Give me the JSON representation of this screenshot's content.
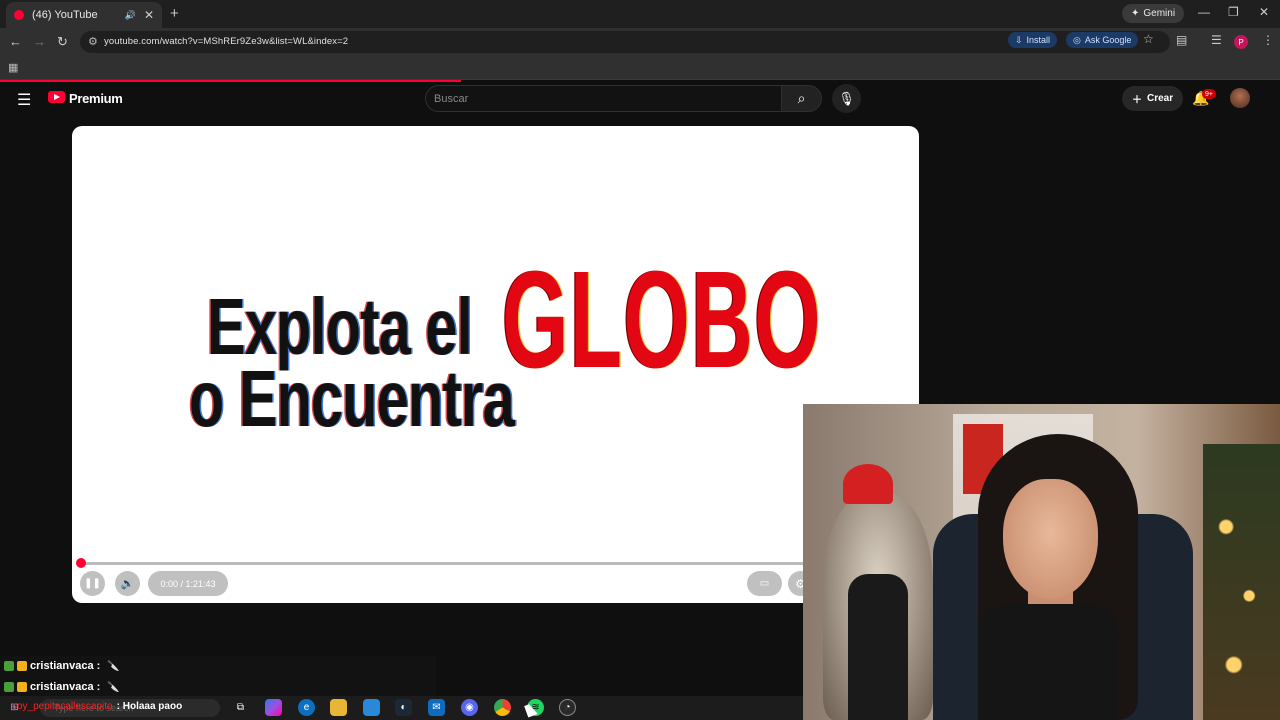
{
  "browser": {
    "tab_title": "(46) YouTube",
    "new_tab": "+",
    "url": "youtube.com/watch?v=MShREr9Ze3w&list=WL&index=2",
    "install_label": "Install",
    "ask_google_label": "Ask Google",
    "gemini_label": "Gemini",
    "profile_initial": "P",
    "load_progress": 0.36
  },
  "youtube": {
    "brand": "Premium",
    "search_placeholder": "Buscar",
    "create_label": "Crear",
    "notification_count": "9+"
  },
  "video": {
    "title_line1": "Explota el",
    "title_line2": "o Encuentra",
    "title_highlight": "GLOBO",
    "time": "0:00 / 1:21:43",
    "progress": 0
  },
  "chat": {
    "messages": [
      {
        "user": "cristianvaca :",
        "emote": "🔪"
      },
      {
        "user": "cristianvaca :",
        "emote": "🔪"
      }
    ]
  },
  "taskbar": {
    "ticker_user": "soy_pepitacallescapito",
    "ticker_message": ": Holaaa paoo",
    "search_placeholder": "Type here to search"
  },
  "colors": {
    "youtube_red": "#ff0033",
    "globo_red": "#e30613"
  }
}
